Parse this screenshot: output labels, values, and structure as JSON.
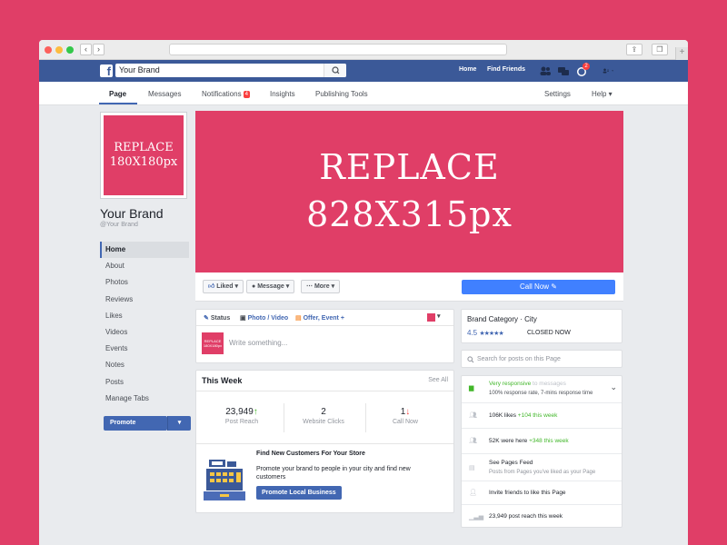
{
  "browser": {
    "back": "‹",
    "forward": "›"
  },
  "header": {
    "search_value": "Your Brand",
    "home": "Home",
    "find_friends": "Find Friends",
    "notif_badge": "2"
  },
  "tabs": {
    "page": "Page",
    "messages": "Messages",
    "notifications": "Notifications",
    "notif_count": "4",
    "insights": "Insights",
    "publishing": "Publishing Tools",
    "settings": "Settings",
    "help": "Help ▾"
  },
  "profile": {
    "photo_line1": "REPLACE",
    "photo_line2": "180X180px",
    "name": "Your Brand",
    "handle": "@Your Brand"
  },
  "leftnav": [
    "Home",
    "About",
    "Photos",
    "Reviews",
    "Likes",
    "Videos",
    "Events",
    "Notes",
    "Posts",
    "Manage Tabs"
  ],
  "promote": {
    "label": "Promote",
    "caret": "▾"
  },
  "cover": {
    "line1": "REPLACE",
    "line2": "828X315px"
  },
  "actions": {
    "liked": "Liked ▾",
    "message": "Message ▾",
    "more": "More ▾",
    "call_now": "Call Now ✎"
  },
  "composer": {
    "status": "Status",
    "photo_video": "Photo / Video",
    "offer_event": "Offer, Event +",
    "avatar_text": "REPLACE 180X180px",
    "placeholder": "Write something..."
  },
  "this_week": {
    "title": "This Week",
    "see_all": "See All",
    "stats": [
      {
        "value": "23,949",
        "arrow": "↑",
        "label": "Post Reach"
      },
      {
        "value": "2",
        "arrow": "",
        "label": "Website Clicks"
      },
      {
        "value": "1",
        "arrow": "↓",
        "label": "Call Now"
      }
    ],
    "ad_title": "Find New Customers For Your Store",
    "ad_text": "Promote your brand to people in your city and find new customers",
    "ad_button": "Promote Local Business"
  },
  "right": {
    "category": "Brand Category · City",
    "rating": "4.5",
    "stars": "★★★★★",
    "closed": "CLOSED NOW",
    "search_placeholder": "Search for posts on this Page",
    "responsive": "Very responsive",
    "to_messages": " to messages",
    "response_rate": "100% response rate, 7-mins response time",
    "likes": "106K likes ",
    "likes_week": "+104 this week",
    "were_here": "52K were here ",
    "were_here_week": "+348 this week",
    "pages_feed": "See Pages Feed",
    "pages_feed_sub": "Posts from Pages you've liked as your Page",
    "invite": "Invite friends to like this Page",
    "reach": "23,949 post reach this week"
  },
  "colors": {
    "brand_pink": "#e03e67",
    "fb_blue": "#3b5998",
    "call_blue": "#4080ff"
  }
}
